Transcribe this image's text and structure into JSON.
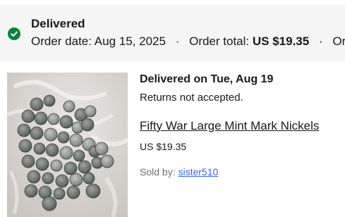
{
  "status": {
    "icon": "check-circle-icon",
    "icon_color": "#05823f",
    "title": "Delivered"
  },
  "summary": {
    "order_date_label": "Order date:",
    "order_date": "Aug 15, 2025",
    "order_total_label": "Order total:",
    "order_total": "US $19.35",
    "order_number_label": "Order"
  },
  "item": {
    "image_icon": "coins-photo",
    "delivery_heading": "Delivered on Tue, Aug 19",
    "returns": "Returns not accepted.",
    "title": "Fifty War Large Mint Mark Nickels",
    "price": "US $19.35",
    "sold_by_label": "Sold by:",
    "seller": "sister510"
  },
  "colors": {
    "header_bg": "#f5f5f5",
    "link": "#3665f3",
    "secondary_text": "#707070"
  }
}
